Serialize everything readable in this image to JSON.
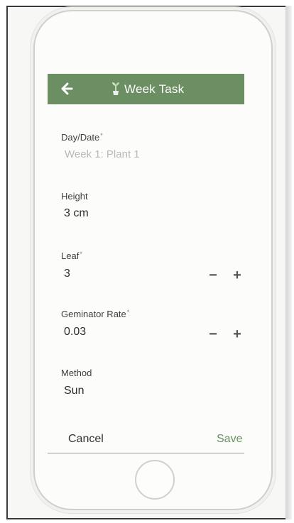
{
  "appbar": {
    "title": "Week Task",
    "back_icon": "arrow-left-icon",
    "title_icon": "plant-icon"
  },
  "form": {
    "day_date": {
      "label": "Day/Date",
      "required_mark": "*",
      "value": "Week 1: Plant 1"
    },
    "height": {
      "label": "Height",
      "value": "3 cm"
    },
    "leaf": {
      "label": "Leaf",
      "required_mark": "*",
      "value": "3",
      "decrement": "−",
      "increment": "+"
    },
    "germinator_rate": {
      "label": "Geminator Rate",
      "required_mark": "*",
      "value": "0.03",
      "decrement": "−",
      "increment": "+"
    },
    "method": {
      "label": "Method",
      "value": "Sun"
    }
  },
  "actions": {
    "cancel": "Cancel",
    "save": "Save"
  },
  "colors": {
    "accent": "#6b8e63",
    "text": "#2d2d2d",
    "muted": "#b9b9b9"
  }
}
